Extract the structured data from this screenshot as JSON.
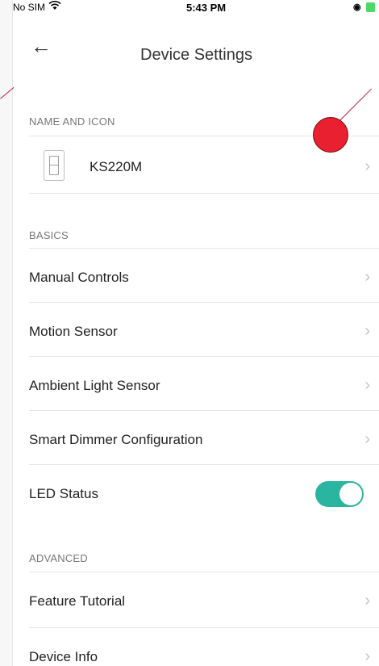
{
  "status_bar": {
    "carrier": "No SIM",
    "wifi_icon": "wifi-icon",
    "time": "5:43 PM",
    "lock_icon": "◉",
    "battery_icon": "battery-icon"
  },
  "nav": {
    "back_icon": "←",
    "title": "Device Settings"
  },
  "sections": {
    "name_and_icon": {
      "header": "NAME AND ICON",
      "device_name": "KS220M",
      "chevron": "›"
    },
    "basics": {
      "header": "BASICS",
      "items": [
        {
          "label": "Manual Controls",
          "chevron": "›"
        },
        {
          "label": "Motion Sensor",
          "chevron": "›"
        },
        {
          "label": "Ambient Light Sensor",
          "chevron": "›"
        },
        {
          "label": "Smart Dimmer Configuration",
          "chevron": "›"
        }
      ],
      "led_status": {
        "label": "LED Status",
        "on": true
      }
    },
    "advanced": {
      "header": "ADVANCED",
      "items": [
        {
          "label": "Feature Tutorial",
          "chevron": "›"
        },
        {
          "label": "Device Info",
          "chevron": "›"
        }
      ]
    }
  },
  "colors": {
    "toggle_on": "#2ab5a0",
    "annotation": "#e8202f"
  }
}
